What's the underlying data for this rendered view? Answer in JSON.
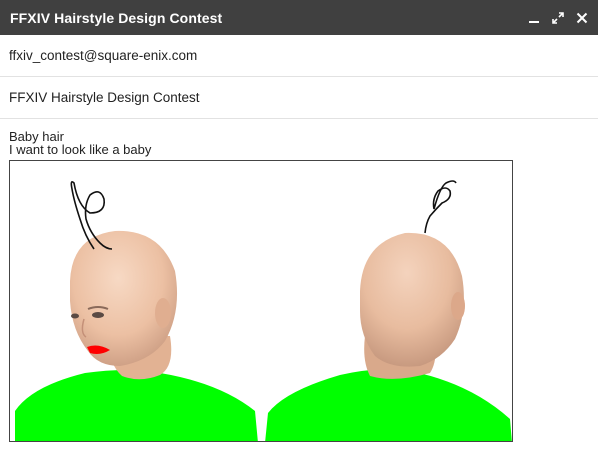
{
  "window": {
    "title": "FFXIV Hairstyle Design Contest",
    "controls": [
      "minimize-icon",
      "expand-icon",
      "close-icon"
    ]
  },
  "compose": {
    "to": "ffxiv_contest@square-enix.com",
    "subject": "FFXIV Hairstyle Design Contest",
    "body_lines": [
      "Baby hair",
      "I want to look like a baby"
    ]
  },
  "attachment": {
    "description_icon": "character-render",
    "colors": {
      "shirt": "#00ff00",
      "lips": "#ff0000",
      "skin": "#f0c6a8",
      "titlebar": "#404040"
    }
  }
}
